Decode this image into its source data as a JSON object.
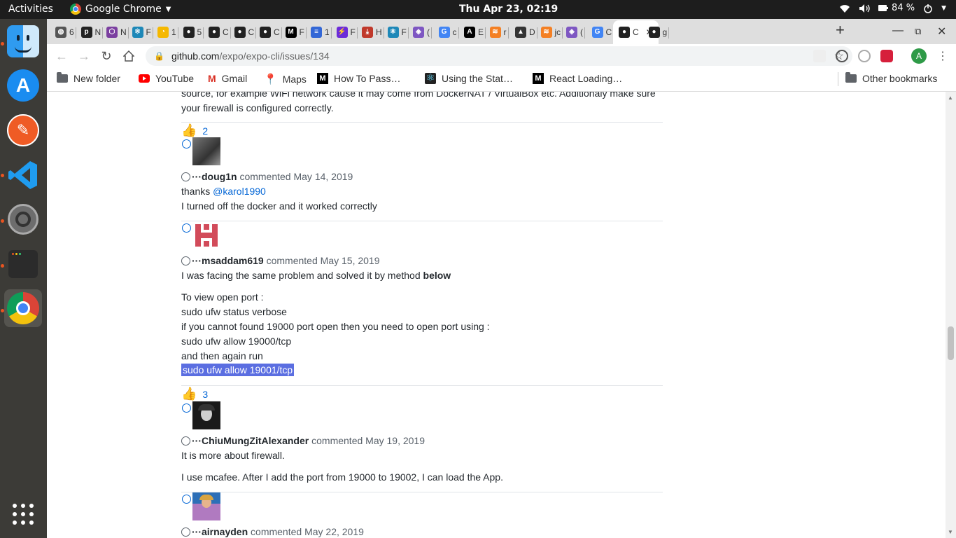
{
  "system": {
    "activities": "Activities",
    "app_name": "Google Chrome",
    "clock": "Thu Apr 23, 02:19",
    "battery": "84 %"
  },
  "dock": {
    "apps": [
      "finder",
      "app-store",
      "postman",
      "vscode",
      "settings",
      "terminal",
      "chrome"
    ]
  },
  "tabs": [
    {
      "label": "6",
      "icon": "globe-icon"
    },
    {
      "label": "N",
      "icon": "pinterest-icon"
    },
    {
      "label": "N",
      "icon": "hexagon-icon"
    },
    {
      "label": "F",
      "icon": "react-icon"
    },
    {
      "label": "1",
      "icon": "q-icon"
    },
    {
      "label": "5",
      "icon": "github-icon"
    },
    {
      "label": "C",
      "icon": "github-icon"
    },
    {
      "label": "C",
      "icon": "github-icon"
    },
    {
      "label": "C",
      "icon": "github-icon"
    },
    {
      "label": "F",
      "icon": "medium-icon"
    },
    {
      "label": "1",
      "icon": "doc-icon"
    },
    {
      "label": "F",
      "icon": "bolt-icon"
    },
    {
      "label": "H",
      "icon": "download-icon"
    },
    {
      "label": "F",
      "icon": "react-icon"
    },
    {
      "label": "(",
      "icon": "redux-icon"
    },
    {
      "label": "c",
      "icon": "google-icon"
    },
    {
      "label": "E",
      "icon": "a-icon"
    },
    {
      "label": "r",
      "icon": "stackoverflow-icon"
    },
    {
      "label": "D",
      "icon": "grad-icon"
    },
    {
      "label": "jc",
      "icon": "stackoverflow-icon"
    },
    {
      "label": "(",
      "icon": "redux-icon"
    },
    {
      "label": "C",
      "icon": "google-icon"
    },
    {
      "label": "C",
      "icon": "github-icon",
      "active": true
    },
    {
      "label": "g",
      "icon": "github-icon"
    }
  ],
  "toolbar": {
    "url_host": "github.com",
    "url_path": "/expo/expo-cli/issues/134",
    "profile_initial": "A"
  },
  "bookmarks": [
    {
      "label": "New folder",
      "icon": "folder-icon"
    },
    {
      "label": "YouTube",
      "icon": "youtube-icon"
    },
    {
      "label": "Gmail",
      "icon": "gmail-icon"
    },
    {
      "label": "Maps",
      "icon": "maps-icon"
    },
    {
      "label": "How To Pass…",
      "icon": "medium-icon"
    },
    {
      "label": "Using the Stat…",
      "icon": "react-icon"
    },
    {
      "label": "React Loading…",
      "icon": "medium-icon"
    }
  ],
  "other_bookmarks": "Other bookmarks",
  "page": {
    "top_text_1": "source, for example WiFi network cause it may come from DockerNAT / VirtualBox etc. Additionaly make sure",
    "top_text_2": "your firewall is configured correctly.",
    "reaction1_count": "2",
    "comment1": {
      "dots": "···",
      "author": "doug1n",
      "verb": "commented",
      "date": "May 14, 2019",
      "line1_prefix": "thanks ",
      "line1_mention": "@karol1990",
      "line2": "I turned off the docker and it worked correctly"
    },
    "comment2": {
      "dots": "···",
      "author": "msaddam619",
      "verb": "commented",
      "date": "May 15, 2019",
      "line1": "I was facing the same problem and solved it by method ",
      "line1_bold": "below",
      "line2": "To view open port :",
      "line3": "sudo ufw status verbose",
      "line4": "if you cannot found 19000 port open then you need to open port using :",
      "line5": "sudo ufw allow 19000/tcp",
      "line6": "and then again run",
      "line7": "sudo ufw allow 19001/tcp"
    },
    "reaction2_count": "3",
    "comment3": {
      "dots": "···",
      "author": "ChiuMungZitAlexander",
      "verb": "commented",
      "date": "May 19, 2019",
      "line1": "It is more about firewall.",
      "line2": "I use mcafee. After I add the port from 19000 to 19002, I can load the App."
    },
    "comment4": {
      "dots": "···",
      "author": "airnayden",
      "verb": "commented",
      "date": "May 22, 2019"
    }
  },
  "colors": {
    "link": "#0366d6",
    "selection": "#5b6ee1",
    "text": "#24292e",
    "muted": "#586069"
  }
}
